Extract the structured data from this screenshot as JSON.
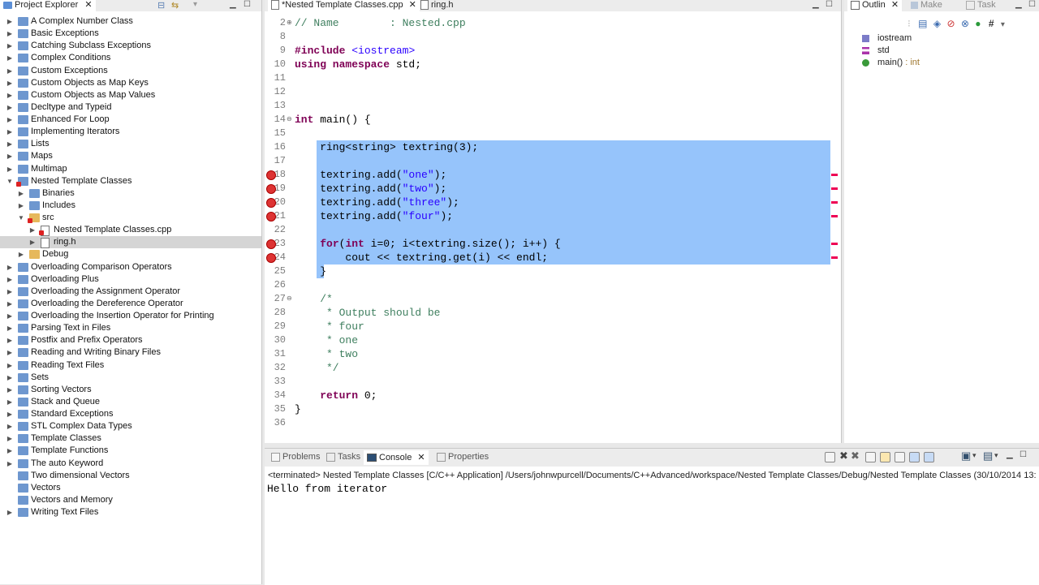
{
  "explorer": {
    "title": "Project Explorer",
    "items": [
      {
        "label": "A Complex Number Class",
        "level": 0,
        "expanded": false
      },
      {
        "label": "Basic Exceptions",
        "level": 0,
        "expanded": false
      },
      {
        "label": "Catching Subclass Exceptions",
        "level": 0,
        "expanded": false
      },
      {
        "label": "Complex Conditions",
        "level": 0,
        "expanded": false
      },
      {
        "label": "Custom Exceptions",
        "level": 0,
        "expanded": false
      },
      {
        "label": "Custom Objects as Map Keys",
        "level": 0,
        "expanded": false
      },
      {
        "label": "Custom Objects as Map Values",
        "level": 0,
        "expanded": false
      },
      {
        "label": "Decltype and Typeid",
        "level": 0,
        "expanded": false
      },
      {
        "label": "Enhanced For Loop",
        "level": 0,
        "expanded": false
      },
      {
        "label": "Implementing Iterators",
        "level": 0,
        "expanded": false
      },
      {
        "label": "Lists",
        "level": 0,
        "expanded": false
      },
      {
        "label": "Maps",
        "level": 0,
        "expanded": false
      },
      {
        "label": "Multimap",
        "level": 0,
        "expanded": false
      },
      {
        "label": "Nested Template Classes",
        "level": 0,
        "expanded": true,
        "error": true
      },
      {
        "label": "Binaries",
        "level": 1,
        "expanded": false
      },
      {
        "label": "Includes",
        "level": 1,
        "expanded": false
      },
      {
        "label": "src",
        "level": 1,
        "expanded": true,
        "error": true
      },
      {
        "label": "Nested Template Classes.cpp",
        "level": 2,
        "expanded": false,
        "error": true
      },
      {
        "label": "ring.h",
        "level": 2,
        "expanded": false,
        "selected": true
      },
      {
        "label": "Debug",
        "level": 1,
        "expanded": false
      },
      {
        "label": "Overloading Comparison Operators",
        "level": 0,
        "expanded": false
      },
      {
        "label": "Overloading Plus",
        "level": 0,
        "expanded": false
      },
      {
        "label": "Overloading the Assignment Operator",
        "level": 0,
        "expanded": false
      },
      {
        "label": "Overloading the Dereference Operator",
        "level": 0,
        "expanded": false
      },
      {
        "label": "Overloading the Insertion Operator for Printing",
        "level": 0,
        "expanded": false
      },
      {
        "label": "Parsing Text in Files",
        "level": 0,
        "expanded": false
      },
      {
        "label": "Postfix and Prefix Operators",
        "level": 0,
        "expanded": false
      },
      {
        "label": "Reading and Writing Binary Files",
        "level": 0,
        "expanded": false
      },
      {
        "label": "Reading Text Files",
        "level": 0,
        "expanded": false
      },
      {
        "label": "Sets",
        "level": 0,
        "expanded": false
      },
      {
        "label": "Sorting Vectors",
        "level": 0,
        "expanded": false
      },
      {
        "label": "Stack and Queue",
        "level": 0,
        "expanded": false
      },
      {
        "label": "Standard Exceptions",
        "level": 0,
        "expanded": false
      },
      {
        "label": "STL Complex Data Types",
        "level": 0,
        "expanded": false
      },
      {
        "label": "Template Classes",
        "level": 0,
        "expanded": false
      },
      {
        "label": "Template Functions",
        "level": 0,
        "expanded": false
      },
      {
        "label": "The auto Keyword",
        "level": 0,
        "expanded": false
      },
      {
        "label": "Two dimensional Vectors",
        "level": 0,
        "expanded": false,
        "no_twisty": true
      },
      {
        "label": "Vectors",
        "level": 0,
        "expanded": false,
        "no_twisty": true
      },
      {
        "label": "Vectors and Memory",
        "level": 0,
        "expanded": false,
        "no_twisty": true
      },
      {
        "label": "Writing Text Files",
        "level": 0,
        "expanded": false
      }
    ]
  },
  "editor": {
    "tabs": [
      {
        "label": "*Nested Template Classes.cpp",
        "active": true
      },
      {
        "label": "ring.h",
        "active": false
      }
    ],
    "lines": [
      {
        "n": "2",
        "html": "<span class='cmt'>// Name        : Nested.cpp</span>",
        "fold": "plus"
      },
      {
        "n": "8",
        "html": ""
      },
      {
        "n": "9",
        "html": "<span class='ppd'>#include</span> <span class='str'>&lt;iostream&gt;</span>"
      },
      {
        "n": "10",
        "html": "<span class='kw'>using namespace</span> std;"
      },
      {
        "n": "11",
        "html": ""
      },
      {
        "n": "12",
        "html": ""
      },
      {
        "n": "13",
        "html": ""
      },
      {
        "n": "14",
        "html": "<span class='kw'>int</span> main() {",
        "fold": "minus"
      },
      {
        "n": "15",
        "html": ""
      },
      {
        "n": "16",
        "html": "    ring&lt;string&gt; textring(3);",
        "sel": true
      },
      {
        "n": "17",
        "html": "",
        "sel": true
      },
      {
        "n": "18",
        "html": "    textring.add(<span class='str'>\"one\"</span>);",
        "sel": true,
        "err": true
      },
      {
        "n": "19",
        "html": "    textring.add(<span class='str'>\"two\"</span>);",
        "sel": true,
        "err": true
      },
      {
        "n": "20",
        "html": "    textring.add(<span class='str'>\"three\"</span>);",
        "sel": true,
        "err": true
      },
      {
        "n": "21",
        "html": "    textring.add(<span class='str'>\"four\"</span>);",
        "sel": true,
        "err": true
      },
      {
        "n": "22",
        "html": "",
        "sel": true
      },
      {
        "n": "23",
        "html": "    <span class='kw'>for</span>(<span class='kw'>int</span> i=0; i&lt;textring.size(); i++) {",
        "sel": true,
        "err": true
      },
      {
        "n": "24",
        "html": "        cout &lt;&lt; textring.get(i) &lt;&lt; endl;",
        "sel": true,
        "err": true
      },
      {
        "n": "25",
        "html": "    }",
        "sel": "partial"
      },
      {
        "n": "26",
        "html": ""
      },
      {
        "n": "27",
        "html": "    <span class='cmt'>/*</span>",
        "fold": "minus"
      },
      {
        "n": "28",
        "html": "<span class='cmt'>     * Output should be</span>"
      },
      {
        "n": "29",
        "html": "<span class='cmt'>     * four</span>"
      },
      {
        "n": "30",
        "html": "<span class='cmt'>     * one</span>"
      },
      {
        "n": "31",
        "html": "<span class='cmt'>     * two</span>"
      },
      {
        "n": "32",
        "html": "<span class='cmt'>     */</span>"
      },
      {
        "n": "33",
        "html": ""
      },
      {
        "n": "34",
        "html": "    <span class='kw'>return</span> 0;"
      },
      {
        "n": "35",
        "html": "}"
      },
      {
        "n": "36",
        "html": ""
      }
    ]
  },
  "outline": {
    "tabs": [
      {
        "label": "Outlin",
        "active": true
      },
      {
        "label": "Make",
        "active": false
      },
      {
        "label": "Task",
        "active": false
      }
    ],
    "items": [
      {
        "label": "iostream",
        "type": ""
      },
      {
        "label": "std",
        "type": ""
      },
      {
        "label": "main()",
        "type": " : int"
      }
    ]
  },
  "console": {
    "tabs": [
      {
        "label": "Problems",
        "active": false
      },
      {
        "label": "Tasks",
        "active": false
      },
      {
        "label": "Console",
        "active": true
      },
      {
        "label": "Properties",
        "active": false
      }
    ],
    "status": "<terminated> Nested Template Classes [C/C++ Application] /Users/johnwpurcell/Documents/C++Advanced/workspace/Nested Template Classes/Debug/Nested Template Classes (30/10/2014 13:",
    "output": "Hello from iterator"
  },
  "colors": {
    "selection": "#96c4fb",
    "keyword": "#7f0055",
    "string": "#2a00ff",
    "comment": "#3f7f5f"
  }
}
